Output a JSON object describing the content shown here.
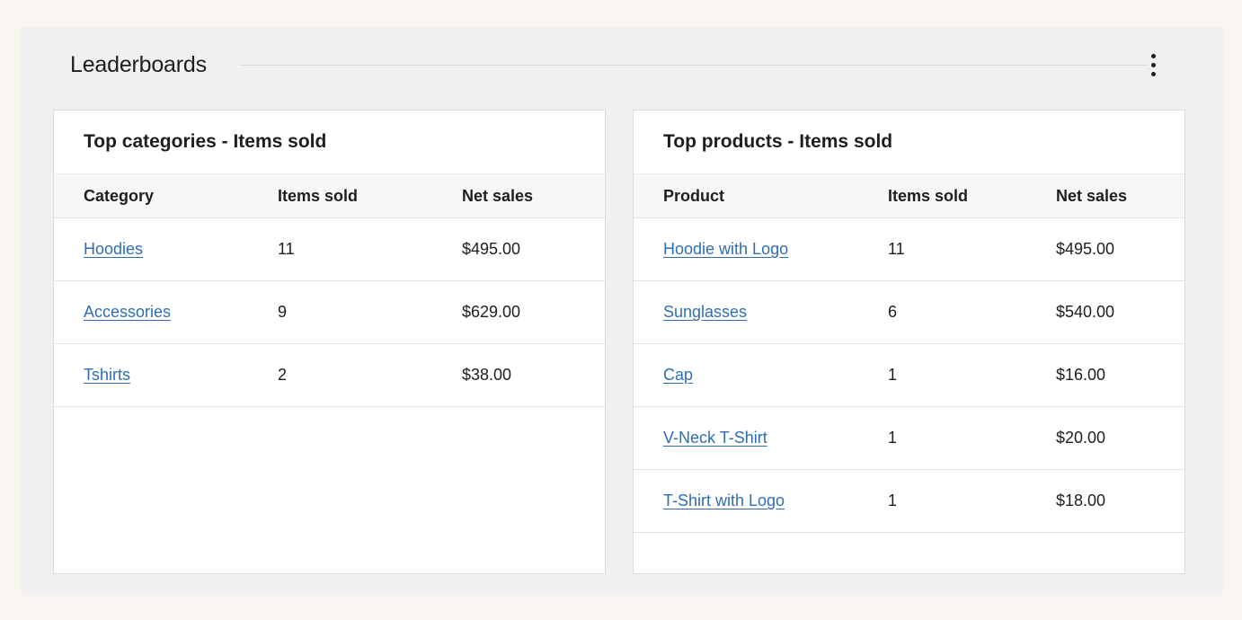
{
  "section": {
    "title": "Leaderboards",
    "menu_label": "More options"
  },
  "categories_card": {
    "title": "Top categories - Items sold",
    "headers": [
      "Category",
      "Items sold",
      "Net sales"
    ],
    "rows": [
      {
        "name": "Hoodies",
        "items": "11",
        "sales": "$495.00"
      },
      {
        "name": "Accessories",
        "items": "9",
        "sales": "$629.00"
      },
      {
        "name": "Tshirts",
        "items": "2",
        "sales": "$38.00"
      }
    ]
  },
  "products_card": {
    "title": "Top products - Items sold",
    "headers": [
      "Product",
      "Items sold",
      "Net sales"
    ],
    "rows": [
      {
        "name": "Hoodie with Logo",
        "items": "11",
        "sales": "$495.00"
      },
      {
        "name": "Sunglasses",
        "items": "6",
        "sales": "$540.00"
      },
      {
        "name": "Cap",
        "items": "1",
        "sales": "$16.00"
      },
      {
        "name": "V-Neck T-Shirt",
        "items": "1",
        "sales": "$20.00"
      },
      {
        "name": "T-Shirt with Logo",
        "items": "1",
        "sales": "$18.00"
      }
    ]
  },
  "colors": {
    "link": "#2f6db5",
    "text": "#1e1e1e",
    "page_bg": "#f9f6f1",
    "section_bg": "#f0f0f0",
    "header_row_bg": "#f6f7f8"
  }
}
